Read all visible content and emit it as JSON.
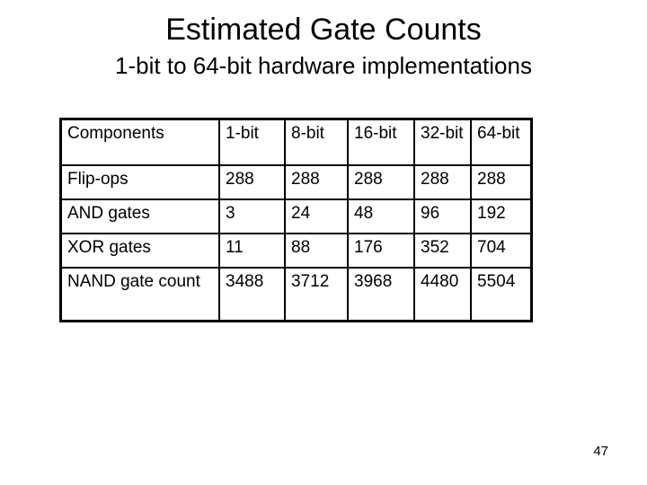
{
  "slide": {
    "title": "Estimated Gate Counts",
    "subtitle": "1-bit to 64-bit hardware implementations",
    "page_number": "47"
  },
  "table": {
    "headers": [
      "Components",
      "1-bit",
      "8-bit",
      "16-bit",
      "32-bit",
      "64-bit"
    ],
    "rows": [
      [
        "Flip-ops",
        "288",
        "288",
        "288",
        "288",
        "288"
      ],
      [
        "AND gates",
        "3",
        "24",
        "48",
        "96",
        "192"
      ],
      [
        "XOR gates",
        "11",
        "88",
        "176",
        "352",
        "704"
      ],
      [
        "NAND gate count",
        "3488",
        "3712",
        "3968",
        "4480",
        "5504"
      ]
    ]
  }
}
